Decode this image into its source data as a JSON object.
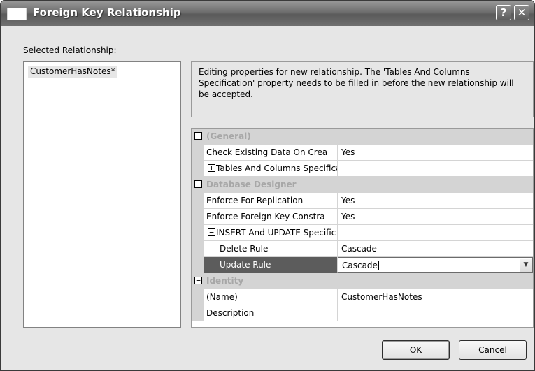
{
  "window": {
    "title": "Foreign Key Relationship",
    "help_glyph": "?",
    "close_glyph": "✕"
  },
  "relationships": {
    "label_accesskey": "S",
    "label_rest": "elected Relationship:",
    "items": [
      "CustomerHasNotes*"
    ]
  },
  "description": "Editing properties for new relationship.  The 'Tables And Columns Specification' property needs to be filled in before the new relationship will be accepted.",
  "properties": {
    "general_category": "(General)",
    "check_existing_name": "Check Existing Data On Crea",
    "check_existing_value": "Yes",
    "tables_columns_name": "Tables And Columns Specifica",
    "tables_columns_value": "",
    "db_designer_category": "Database Designer",
    "enforce_replication_name": "Enforce For Replication",
    "enforce_replication_value": "Yes",
    "enforce_fk_name": "Enforce Foreign Key Constra",
    "enforce_fk_value": "Yes",
    "insert_update_name": "INSERT And UPDATE Specific",
    "insert_update_value": "",
    "delete_rule_name": "Delete Rule",
    "delete_rule_value": "Cascade",
    "update_rule_name": "Update Rule",
    "update_rule_value": "Cascade",
    "identity_category": "Identity",
    "name_name": "(Name)",
    "name_value": "CustomerHasNotes",
    "description_name": "Description",
    "description_value": "",
    "expanded_glyph": "−",
    "collapsed_glyph": "+"
  },
  "buttons": {
    "ok": "OK",
    "cancel": "Cancel"
  },
  "icons": {
    "window": "window-icon",
    "help": "help-icon",
    "close": "close-icon",
    "dropdown": "chevron-down-icon",
    "expand": "plus-box-icon",
    "collapse": "minus-box-icon"
  }
}
